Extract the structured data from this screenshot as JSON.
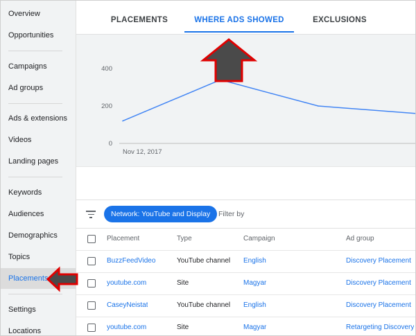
{
  "sidebar": {
    "items": [
      {
        "label": "Overview"
      },
      {
        "label": "Opportunities"
      },
      {
        "label": "Campaigns"
      },
      {
        "label": "Ad groups"
      },
      {
        "label": "Ads & extensions"
      },
      {
        "label": "Videos"
      },
      {
        "label": "Landing pages"
      },
      {
        "label": "Keywords"
      },
      {
        "label": "Audiences"
      },
      {
        "label": "Demographics"
      },
      {
        "label": "Topics"
      },
      {
        "label": "Placements"
      },
      {
        "label": "Settings"
      },
      {
        "label": "Locations"
      }
    ],
    "active": "Placements"
  },
  "tabs": [
    {
      "label": "PLACEMENTS"
    },
    {
      "label": "WHERE ADS SHOWED"
    },
    {
      "label": "EXCLUSIONS"
    }
  ],
  "active_tab": "WHERE ADS SHOWED",
  "chart_data": {
    "type": "line",
    "x": [
      "Nov 12, 2017",
      "",
      "",
      ""
    ],
    "series": [
      {
        "values": [
          120,
          340,
          200,
          160
        ]
      }
    ],
    "yticks": [
      "400",
      "200",
      "0"
    ],
    "xtick": "Nov 12, 2017",
    "ylim": [
      0,
      400
    ],
    "line_color": "#4285f4",
    "grid": false
  },
  "filter": {
    "chip_label": "Network: YouTube and Display",
    "placeholder": "Filter by"
  },
  "table": {
    "columns": [
      "Placement",
      "Type",
      "Campaign",
      "Ad group"
    ],
    "rows": [
      {
        "placement": "BuzzFeedVideo",
        "type": "YouTube channel",
        "campaign": "English",
        "ad_group": "Discovery Placement"
      },
      {
        "placement": "youtube.com",
        "type": "Site",
        "campaign": "Magyar",
        "ad_group": "Discovery Placement"
      },
      {
        "placement": "CaseyNeistat",
        "type": "YouTube channel",
        "campaign": "English",
        "ad_group": "Discovery Placement"
      },
      {
        "placement": "youtube.com",
        "type": "Site",
        "campaign": "Magyar",
        "ad_group": "Retargeting Discovery"
      }
    ]
  },
  "annotation_colors": {
    "arrow_fill": "#4a4a4a",
    "arrow_stroke": "#e00000"
  }
}
